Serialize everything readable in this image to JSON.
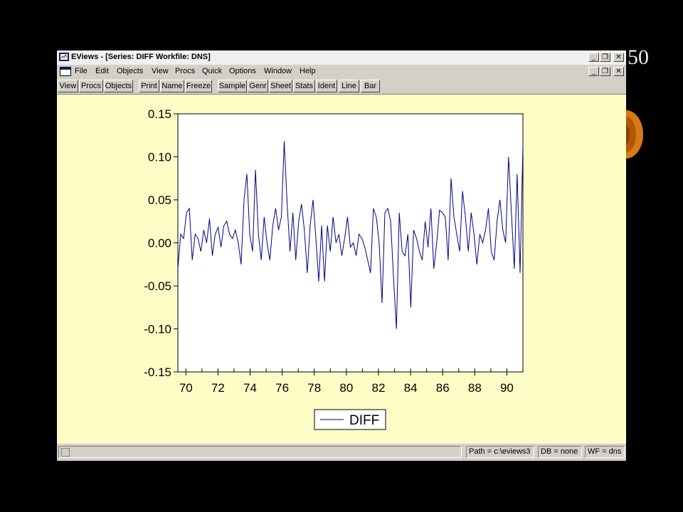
{
  "slide_number": "50",
  "window": {
    "title": "EViews - [Series: DIFF   Workfile: DNS]",
    "menu": [
      "File",
      "Edit",
      "Objects",
      "View",
      "Procs",
      "Quick",
      "Options",
      "Window",
      "Help"
    ],
    "toolbar": [
      "View",
      "Procs",
      "Objects",
      "Print",
      "Name",
      "Freeze",
      "Sample",
      "Genr",
      "Sheet",
      "Stats",
      "Ident",
      "Line",
      "Bar"
    ],
    "status": {
      "path": "Path = c:\\eviews3",
      "db": "DB = none",
      "wf": "WF = dns"
    }
  },
  "colors": {
    "content_bg": "#fffdc6",
    "line": "#00008b"
  },
  "chart_data": {
    "type": "line",
    "series": [
      {
        "name": "DIFF",
        "x_start": 1969.5,
        "x_end": 1991.0,
        "values": [
          -0.03,
          0.01,
          0.005,
          0.035,
          0.04,
          -0.02,
          0.01,
          0.005,
          -0.01,
          0.015,
          0.0,
          0.028,
          -0.015,
          0.01,
          0.018,
          -0.005,
          0.02,
          0.025,
          0.01,
          0.005,
          0.015,
          0.0,
          -0.025,
          0.05,
          0.08,
          0.01,
          -0.01,
          0.085,
          0.01,
          -0.02,
          0.03,
          0.0,
          -0.02,
          0.02,
          0.04,
          0.015,
          0.03,
          0.118,
          0.045,
          -0.01,
          0.035,
          -0.02,
          0.025,
          0.045,
          0.015,
          -0.035,
          0.02,
          0.05,
          0.005,
          -0.045,
          0.02,
          -0.045,
          0.02,
          -0.01,
          0.03,
          0.0,
          0.01,
          -0.015,
          0.005,
          0.03,
          -0.005,
          0.0,
          -0.015,
          0.01,
          0.005,
          -0.005,
          -0.02,
          -0.035,
          0.04,
          0.03,
          0.0,
          -0.07,
          0.035,
          0.04,
          0.025,
          -0.04,
          -0.1,
          0.035,
          -0.01,
          -0.015,
          0.01,
          -0.075,
          0.015,
          0.005,
          -0.01,
          -0.02,
          0.025,
          -0.005,
          0.04,
          -0.03,
          0.0,
          0.038,
          0.035,
          0.03,
          -0.02,
          0.075,
          0.03,
          0.01,
          -0.01,
          0.06,
          0.03,
          -0.01,
          0.035,
          0.01,
          -0.025,
          0.01,
          0.0,
          0.015,
          0.04,
          -0.01,
          -0.02,
          0.025,
          0.05,
          0.015,
          0.0,
          0.1,
          0.035,
          -0.03,
          0.08,
          -0.035,
          0.113
        ]
      }
    ],
    "x_tick_labels": [
      "70",
      "72",
      "74",
      "76",
      "78",
      "80",
      "82",
      "84",
      "86",
      "88",
      "90"
    ],
    "x_ticks": [
      1970,
      1972,
      1974,
      1976,
      1978,
      1980,
      1982,
      1984,
      1986,
      1988,
      1990
    ],
    "y_tick_labels": [
      "0.15",
      "0.10",
      "0.05",
      "0.00",
      "-0.05",
      "-0.10",
      "-0.15"
    ],
    "y_ticks": [
      0.15,
      0.1,
      0.05,
      0.0,
      -0.05,
      -0.1,
      -0.15
    ],
    "xlim": [
      1969.5,
      1991.0
    ],
    "ylim": [
      -0.15,
      0.15
    ],
    "legend": "bottom-center",
    "grid": false
  }
}
